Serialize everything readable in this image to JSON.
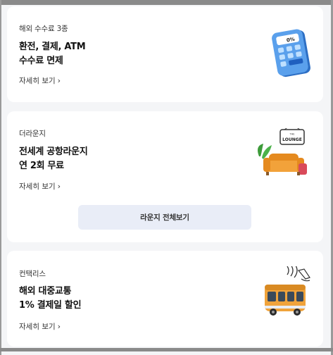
{
  "cards": [
    {
      "category": "해외 수수료 3종",
      "title_line1": "환전, 결제, ATM",
      "title_line2": "수수료 면제",
      "more_label": "자세히 보기",
      "icon": "calculator-icon",
      "icon_text": "0%"
    },
    {
      "category": "더라운지",
      "title_line1": "전세계 공항라운지",
      "title_line2": "연 2회 무료",
      "more_label": "자세히 보기",
      "icon": "lounge-sofa-icon",
      "sign_small": "THE",
      "sign_big": "LOUNGE",
      "button_label": "라운지 전체보기"
    },
    {
      "category": "컨택리스",
      "title_line1": "해외 대중교통",
      "title_line2": "1% 결제일 할인",
      "more_label": "자세히 보기",
      "icon": "contactless-bus-icon"
    }
  ],
  "colors": {
    "background": "#f4f5f7",
    "card": "#ffffff",
    "button_bg": "#e9edf7",
    "calculator_blue": "#4a90e2",
    "sofa_orange": "#f2a23a",
    "bus_orange": "#f0a33b"
  }
}
